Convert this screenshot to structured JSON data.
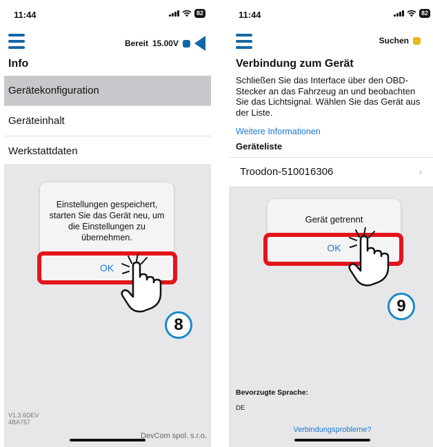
{
  "left": {
    "status_time": "11:44",
    "battery": "82",
    "nav_status": "Bereit",
    "voltage": "15.00V",
    "colors": {
      "accent": "#1566a6",
      "status_square": "#1566a6"
    },
    "title": "Info",
    "menu": [
      {
        "label": "Gerätekonfiguration",
        "active": true
      },
      {
        "label": "Geräteinhalt",
        "active": false
      },
      {
        "label": "Werkstattdaten",
        "active": false
      }
    ],
    "alert": {
      "message": "Einstellungen gespeichert, starten Sie das Gerät neu, um die Einstellungen zu übernehmen.",
      "ok_label": "OK"
    },
    "step_number": "8",
    "version_line1": "V1.3.6DEV",
    "version_line2": "4BA757",
    "company": "DevCom spol. s.r.o."
  },
  "right": {
    "status_time": "11:44",
    "battery": "82",
    "nav_status": "Suchen",
    "colors": {
      "status_square": "#e5b91b"
    },
    "title": "Verbindung zum Gerät",
    "description": "Schließen Sie das Interface über den OBD-Stecker an das Fahrzeug an und beobachten Sie das Lichtsignal. Wählen Sie das Gerät aus der Liste.",
    "more_info_link": "Weitere Informationen",
    "device_list_label": "Geräteliste",
    "devices": [
      {
        "name": "Troodon-510016306"
      }
    ],
    "alert": {
      "message": "Gerät getrennt",
      "ok_label": "OK"
    },
    "step_number": "9",
    "language_label": "Bevorzugte Sprache:",
    "language_value": "DE",
    "connection_problems_link": "Verbindungsprobleme?"
  },
  "icons": {
    "menu": "hamburger-menu-icon",
    "signal": "signal-bars-icon",
    "wifi": "wifi-icon",
    "battery": "battery-icon",
    "connection": "blue-triangle-icon",
    "chevron": "chevron-right-icon",
    "hand": "tapping-hand-icon"
  }
}
